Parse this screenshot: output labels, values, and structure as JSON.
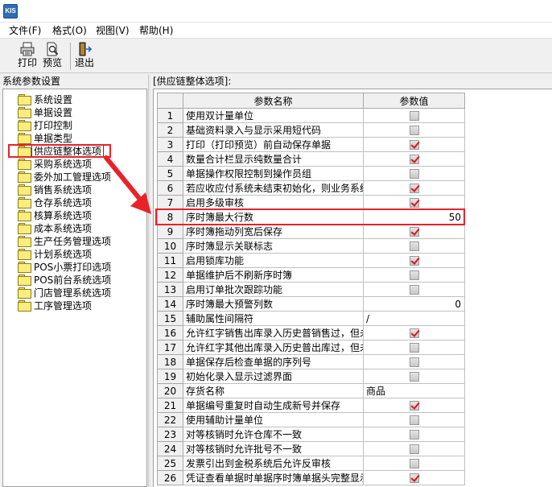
{
  "app": {
    "logo_text": "KIS"
  },
  "menu": [
    "文件(F)",
    "格式(O)",
    "视图(V)",
    "帮助(H)"
  ],
  "toolbar": {
    "print_label": "打印",
    "preview_label": "预览",
    "exit_label": "退出"
  },
  "left_panel": {
    "title": "系统参数设置",
    "items": [
      "系统设置",
      "单据设置",
      "打印控制",
      "单据类型",
      "供应链整体选项",
      "采购系统选项",
      "委外加工管理选项",
      "销售系统选项",
      "仓存系统选项",
      "核算系统选项",
      "成本系统选项",
      "生产任务管理选项",
      "计划系统选项",
      "POS小票打印选项",
      "POS前台系统选项",
      "门店管理系统选项",
      "工序管理选项"
    ],
    "selected_index": 4
  },
  "right_panel": {
    "title": "[供应链整体选项]:",
    "columns": [
      "参数名称",
      "参数值"
    ],
    "rows": [
      {
        "no": "1",
        "name": "使用双计量单位",
        "type": "check",
        "checked": false
      },
      {
        "no": "2",
        "name": "基础资料录入与显示采用短代码",
        "type": "check",
        "checked": false
      },
      {
        "no": "3",
        "name": "打印（打印预览）前自动保存单据",
        "type": "check",
        "checked": true
      },
      {
        "no": "4",
        "name": "数量合计栏显示纯数量合计",
        "type": "check",
        "checked": true
      },
      {
        "no": "5",
        "name": "单据操作权限控制到操作员组",
        "type": "check",
        "checked": false
      },
      {
        "no": "6",
        "name": "若应收应付系统未结束初始化，则业务系统",
        "type": "check",
        "checked": true
      },
      {
        "no": "7",
        "name": "启用多级审核",
        "type": "check",
        "checked": true
      },
      {
        "no": "8",
        "name": "序时簿最大行数",
        "type": "number",
        "value": "50"
      },
      {
        "no": "9",
        "name": "序时簿拖动列宽后保存",
        "type": "check",
        "checked": true
      },
      {
        "no": "10",
        "name": "序时簿显示关联标志",
        "type": "check",
        "checked": false
      },
      {
        "no": "11",
        "name": "启用锁库功能",
        "type": "check",
        "checked": true
      },
      {
        "no": "12",
        "name": "单据维护后不刷新序时簿",
        "type": "check",
        "checked": false
      },
      {
        "no": "13",
        "name": "启用订单批次跟踪功能",
        "type": "check",
        "checked": false
      },
      {
        "no": "14",
        "name": "序时簿最大预警列数",
        "type": "number",
        "value": "0"
      },
      {
        "no": "15",
        "name": "辅助属性间隔符",
        "type": "text",
        "value": "/"
      },
      {
        "no": "16",
        "name": "允许红字销售出库录入历史普销售过，但未",
        "type": "check",
        "checked": true
      },
      {
        "no": "17",
        "name": "允许红字其他出库录入历史普出库过，但未",
        "type": "check",
        "checked": false
      },
      {
        "no": "18",
        "name": "单据保存后检查单据的序列号",
        "type": "check",
        "checked": false
      },
      {
        "no": "19",
        "name": "初始化录入显示过滤界面",
        "type": "check",
        "checked": false
      },
      {
        "no": "20",
        "name": "存货名称",
        "type": "text",
        "value": "商品"
      },
      {
        "no": "21",
        "name": "单据编号重复时自动生成新号并保存",
        "type": "check",
        "checked": true
      },
      {
        "no": "22",
        "name": "使用辅助计量单位",
        "type": "check",
        "checked": false
      },
      {
        "no": "23",
        "name": "对等核销时允许仓库不一致",
        "type": "check",
        "checked": false
      },
      {
        "no": "24",
        "name": "对等核销时允许批号不一致",
        "type": "check",
        "checked": false
      },
      {
        "no": "25",
        "name": "发票引出到金税系统后允许反审核",
        "type": "check",
        "checked": false
      },
      {
        "no": "26",
        "name": "凭证查看单据时单据序时簿单据头完整显示",
        "type": "check",
        "checked": true
      }
    ],
    "highlighted_row": 8
  },
  "colors": {
    "annotation_red": "#e8222a",
    "check_red": "#e0141e"
  }
}
